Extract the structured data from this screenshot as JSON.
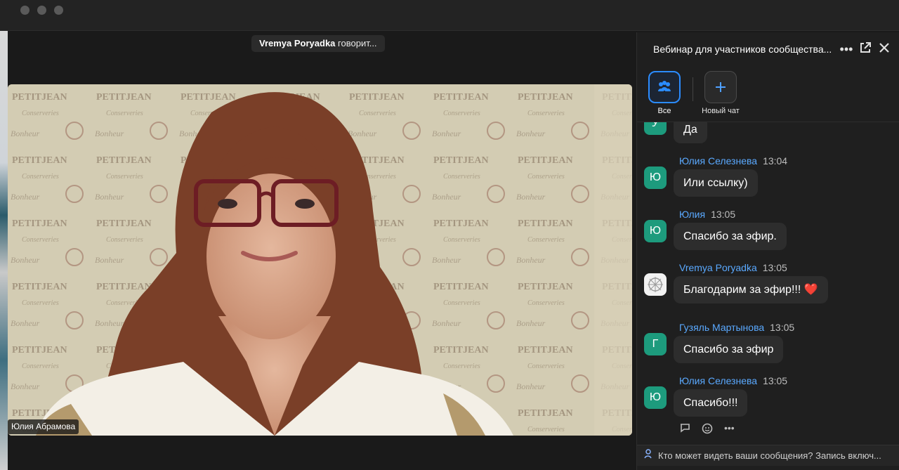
{
  "speaker": {
    "name": "Vremya Poryadka",
    "suffix": "говорит..."
  },
  "video": {
    "participant_name": "Юлия Абрамова"
  },
  "chat": {
    "title": "Вебинар для участников сообщества...",
    "tabs": [
      {
        "label": "Все",
        "icon": "people-icon",
        "active": true
      },
      {
        "label": "Новый чат",
        "icon": "plus-icon",
        "active": false
      }
    ],
    "messages": [
      {
        "avatar": "У",
        "sender": "",
        "time": "",
        "text": "Да"
      },
      {
        "avatar": "Ю",
        "sender": "Юлия Селезнева",
        "time": "13:04",
        "text": "Или ссылку)"
      },
      {
        "avatar": "Ю",
        "sender": "Юлия",
        "time": "13:05",
        "text": "Спасибо за эфир."
      },
      {
        "avatar": "",
        "sender": "Vremya Poryadka",
        "time": "13:05",
        "text": "Благодарим за эфир!!! ❤️"
      },
      {
        "avatar": "Г",
        "sender": "Гузяль Мартынова",
        "time": "13:05",
        "text": "Спасибо за эфир"
      },
      {
        "avatar": "Ю",
        "sender": "Юлия Селезнева",
        "time": "13:05",
        "text": "Спасибо!!!"
      }
    ],
    "footer": "Кто может видеть ваши сообщения? Запись включ..."
  },
  "colors": {
    "accent": "#2b8cff",
    "sender": "#5aa9ff",
    "avatar": "#1d9b7d"
  }
}
